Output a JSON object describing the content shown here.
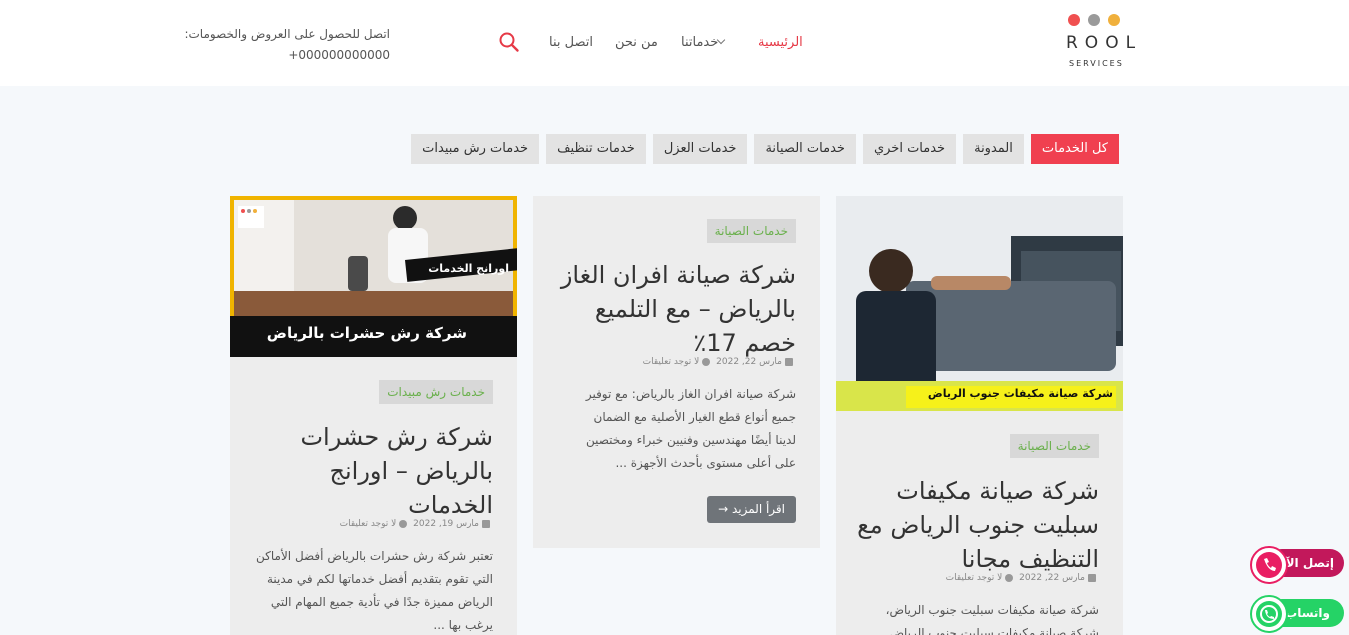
{
  "colors": {
    "accent": "#f04050",
    "tag_green": "#6ab04c",
    "call_pink": "#c2185b",
    "whatsapp": "#25d366",
    "logo_red": "#f05050",
    "logo_gray": "#9a9a9a",
    "logo_yellow": "#f0b03c"
  },
  "logo": {
    "word": "ROOL",
    "sub": "SERVICES"
  },
  "nav": {
    "home": "الرئيسية",
    "services": "خدماتنا",
    "about": "من نحن",
    "contact": "اتصل بنا"
  },
  "promo": {
    "text": "اتصل للحصول على العروض والخصومات:",
    "phone": "000000000000+"
  },
  "icons": {
    "search": "search-icon",
    "calendar": "calendar-icon",
    "comments": "comments-icon",
    "phone": "phone-icon",
    "whatsapp": "whatsapp-icon",
    "chevron": "chevron-down-icon"
  },
  "filters": [
    "كل الخدمات",
    "المدونة",
    "خدمات اخري",
    "خدمات الصيانة",
    "خدمات العزل",
    "خدمات تنظيف",
    "خدمات رش مبيدات"
  ],
  "posts": [
    {
      "category": "خدمات الصيانة",
      "title": "شركة صيانة مكيفات سبليت جنوب الرياض مع التنظيف مجانا",
      "date": "مارس 22, 2022",
      "comments": "لا توجد تعليقات",
      "excerpt": "شركة صيانة مكيفات سبليت جنوب الرياض، شركة صيانة مكيفات سبليت جنوب الرياض",
      "image_caption": "شركة صيانة مكيفات جنوب الرياض"
    },
    {
      "category": "خدمات الصيانة",
      "title": "شركة صيانة افران الغاز بالرياض – مع التلميع خصم 17٪",
      "date": "مارس 22, 2022",
      "comments": "لا توجد تعليقات",
      "excerpt": "شركة صيانة افران الغاز بالرياض: مع توفير جميع أنواع قطع الغيار الأصلية مع الضمان لدينا أيضًا مهندسين وفنيين خبراء ومختصين على أعلى مستوى بأحدث الأجهزة ...",
      "read_more": "اقرأ المزيد →"
    },
    {
      "category": "خدمات رش مبيدات",
      "title": "شركة رش حشرات بالرياض – اورانج الخدمات",
      "date": "مارس 19, 2022",
      "comments": "لا توجد تعليقات",
      "excerpt": "تعتبر شركة رش حشرات بالرياض أفضل الأماكن التي تقوم بتقديم أفضل خدماتها لكم في مدينة الرياض مميزة جدًا في تأدية جميع المهام التي يرغب بها ...",
      "image_caption": "شركة رش حشرات بالرياض",
      "image_badge": "اورانج الخدمات"
    }
  ],
  "floating": {
    "call": "إتصل الآن",
    "whatsapp": "واتساب"
  }
}
